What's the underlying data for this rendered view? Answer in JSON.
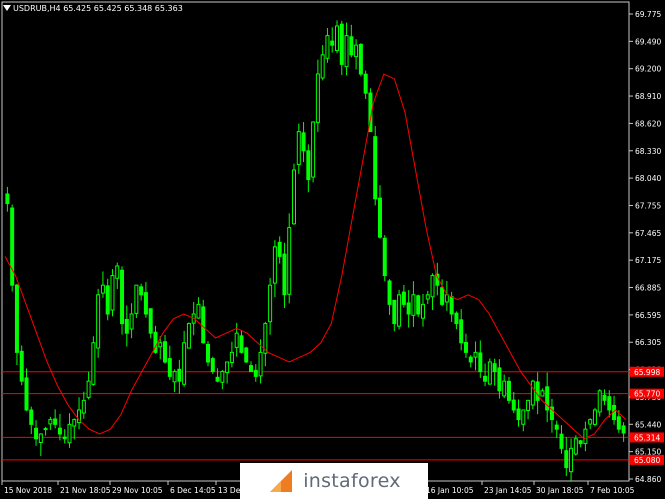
{
  "header": {
    "title": "USDRUB,H4  65.425 65.425 65.348 65.363"
  },
  "logo": {
    "text": "instaforex"
  },
  "colors": {
    "background": "#000000",
    "candle_bull": "#00ff00",
    "candle_bear": "#00ff00",
    "moving_average": "#ff0000",
    "level_lines": "#ff0000",
    "level_label_bg": "#ff0000",
    "axis_text": "#ffffff"
  },
  "chart_data": {
    "type": "candlestick",
    "symbol": "USDRUB",
    "timeframe": "H4",
    "ylim": [
      64.86,
      69.85
    ],
    "y_ticks": [
      "69.775",
      "69.490",
      "69.200",
      "68.910",
      "68.620",
      "68.330",
      "68.040",
      "67.755",
      "67.465",
      "67.175",
      "66.885",
      "66.595",
      "66.305",
      "66.020",
      "65.730",
      "65.440",
      "65.150",
      "64.860"
    ],
    "x_tick_labels": [
      "15 Nov 2018",
      "21 Nov 18:05",
      "29 Nov 10:05",
      "6 Dec 14:05",
      "13 Dec",
      "16 Jan 10:05",
      "23 Jan 14:05",
      "30 Jan 18:05",
      "7 Feb 10:05"
    ],
    "levels": [
      {
        "value": "65.998",
        "y": 65.998
      },
      {
        "value": "65.770",
        "y": 65.77
      },
      {
        "value": "65.314",
        "y": 65.314
      },
      {
        "value": "65.080",
        "y": 65.08
      }
    ],
    "close_series": [
      67.75,
      66.9,
      66.2,
      65.9,
      65.6,
      65.45,
      65.3,
      65.35,
      65.4,
      65.5,
      65.45,
      65.35,
      65.3,
      65.45,
      65.5,
      65.6,
      65.7,
      65.9,
      66.3,
      66.8,
      66.9,
      66.6,
      67.0,
      67.1,
      66.5,
      66.4,
      66.6,
      66.9,
      66.8,
      66.6,
      66.4,
      66.2,
      66.3,
      66.1,
      65.95,
      66.0,
      65.9,
      66.3,
      66.5,
      66.6,
      66.7,
      66.3,
      66.1,
      66.0,
      65.9,
      66.0,
      66.1,
      66.2,
      66.4,
      66.2,
      66.1,
      66.0,
      65.95,
      66.2,
      66.5,
      66.9,
      67.3,
      67.2,
      66.8,
      67.5,
      68.1,
      68.5,
      68.3,
      68.0,
      68.6,
      69.1,
      69.3,
      69.5,
      69.4,
      69.6,
      69.2,
      69.5,
      69.3,
      69.4,
      69.1,
      68.9,
      68.5,
      67.8,
      67.4,
      67.0,
      66.7,
      66.5,
      66.8,
      66.7,
      66.6,
      66.8,
      66.6,
      66.7,
      66.8,
      67.0,
      66.9,
      66.7,
      66.8,
      66.6,
      66.5,
      66.3,
      66.2,
      66.1,
      66.2,
      66.0,
      65.9,
      66.1,
      66.0,
      65.8,
      65.9,
      65.7,
      65.6,
      65.5,
      65.6,
      65.7,
      65.9,
      65.7,
      65.8,
      65.6,
      65.5,
      65.4,
      65.2,
      65.0,
      65.2,
      65.3,
      65.25,
      65.4,
      65.5,
      65.6,
      65.8,
      65.7,
      65.6,
      65.5,
      65.4,
      65.36
    ],
    "ma_series": [
      67.2,
      67.0,
      66.7,
      66.4,
      66.1,
      65.85,
      65.65,
      65.5,
      65.4,
      65.35,
      65.4,
      65.55,
      65.8,
      66.0,
      66.2,
      66.4,
      66.55,
      66.6,
      66.55,
      66.45,
      66.35,
      66.4,
      66.45,
      66.4,
      66.3,
      66.2,
      66.15,
      66.1,
      66.15,
      66.2,
      66.3,
      66.5,
      67.0,
      67.6,
      68.2,
      68.8,
      69.1,
      69.05,
      68.7,
      68.1,
      67.5,
      67.0,
      66.8,
      66.75,
      66.8,
      66.75,
      66.6,
      66.4,
      66.2,
      66.0,
      65.85,
      65.7,
      65.6,
      65.5,
      65.4,
      65.3,
      65.35,
      65.5,
      65.6,
      65.5
    ]
  }
}
